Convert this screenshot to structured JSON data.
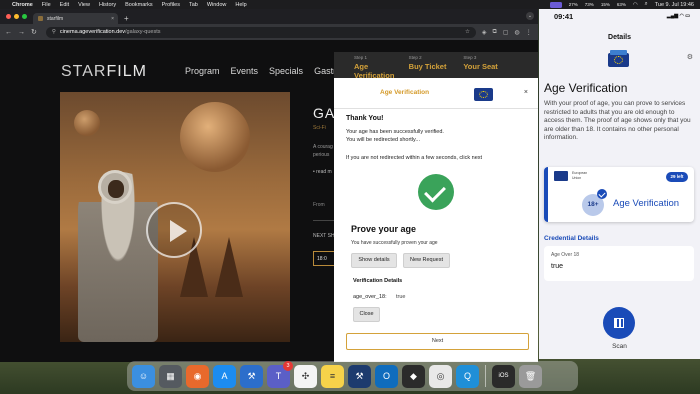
{
  "menubar": {
    "items": [
      "Chrome",
      "File",
      "Edit",
      "View",
      "History",
      "Bookmarks",
      "Profiles",
      "Tab",
      "Window",
      "Help"
    ],
    "status_items": [
      "27%",
      "73%",
      "15%",
      "63%"
    ],
    "clock": "Tue 9. Jul 19:46"
  },
  "browser": {
    "tab_title": "starfilm",
    "tab_close": "×",
    "new_tab": "+",
    "url_host": "cinema.ageverification.dev",
    "url_path": "/galaxy-quests"
  },
  "site": {
    "logo_a": "STAR",
    "logo_b": "FILM",
    "nav": [
      "Program",
      "Events",
      "Specials",
      "Gastro"
    ],
    "side_title": "GAL",
    "side_sub": "Sci-Fi",
    "side_text": "A courag perious",
    "side_read": "• read m",
    "side_from": "From",
    "side_next": "NEXT SH",
    "side_btn": "18:0"
  },
  "steps": [
    {
      "label": "Step 1",
      "value": "Age Verification"
    },
    {
      "label": "Step 2",
      "value": "Buy Ticket"
    },
    {
      "label": "Step 3",
      "value": "Your Seat"
    }
  ],
  "modal": {
    "title": "Age Verification",
    "close": "×",
    "thank_you": "Thank You!",
    "verified_line1": "Your age has been successfully verified.",
    "verified_line2": "You will be redirected shortly...",
    "redirect_note": "If you are not redirected within a few seconds, click next",
    "prove_title": "Prove your age",
    "prove_sub": "You have successfully proven your age",
    "show_details": "Show details",
    "new_request": "New Request",
    "details_title": "Verification Details",
    "detail_key": "age_over_18:",
    "detail_value": "true",
    "close_button": "Close",
    "next_button": "Next"
  },
  "phone": {
    "time": "09:41",
    "signal": "▂▄▆ ◠ ▭",
    "header": "Details",
    "heading": "Age Verification",
    "description": "With your proof of age, you can prove to services restricted to adults that you are old enough to access them. The proof of age shows only that you are older than 18. It contains no other personal information.",
    "card_issuer_line1": "European",
    "card_issuer_line2": "Union",
    "card_left": "29 left",
    "card_age": "18+",
    "card_name": "Age Verification",
    "credential_details_title": "Credential Details",
    "detail_key": "Age Over 18",
    "detail_value": "true",
    "scan_label": "Scan"
  },
  "dock": {
    "apps": [
      {
        "name": "finder-icon",
        "color": "#3b8fe0",
        "glyph": "☺"
      },
      {
        "name": "launchpad-icon",
        "color": "#555a60",
        "glyph": "▦"
      },
      {
        "name": "firefox-icon",
        "color": "#e8692c",
        "glyph": "◉"
      },
      {
        "name": "appstore-icon",
        "color": "#1c8cf0",
        "glyph": "A"
      },
      {
        "name": "xcode-icon",
        "color": "#2c6ecb",
        "glyph": "⚒"
      },
      {
        "name": "teams-icon",
        "color": "#5b5fc7",
        "glyph": "T",
        "badge": "3"
      },
      {
        "name": "slack-icon",
        "color": "#f4f4f4",
        "glyph": "✣"
      },
      {
        "name": "notes-icon",
        "color": "#f6d24a",
        "glyph": "≡"
      },
      {
        "name": "xcode2-icon",
        "color": "#1d3b6e",
        "glyph": "⚒"
      },
      {
        "name": "outlook-icon",
        "color": "#0f6cbd",
        "glyph": "O"
      },
      {
        "name": "unity-icon",
        "color": "#2b2b2b",
        "glyph": "◆"
      },
      {
        "name": "chrome-icon",
        "color": "#e8e8e8",
        "glyph": "◎"
      },
      {
        "name": "proxyman-icon",
        "color": "#1f8fd8",
        "glyph": "Q"
      }
    ],
    "extra": [
      {
        "name": "simulator-icon",
        "color": "#2a2a2a",
        "glyph": "iOS"
      },
      {
        "name": "trash-icon",
        "color": "#9a9a9a",
        "glyph": "🗑"
      }
    ]
  },
  "colors": {
    "accent_gold": "#d4a23a",
    "eu_blue": "#1a4bb8",
    "success_green": "#3aa35a"
  }
}
